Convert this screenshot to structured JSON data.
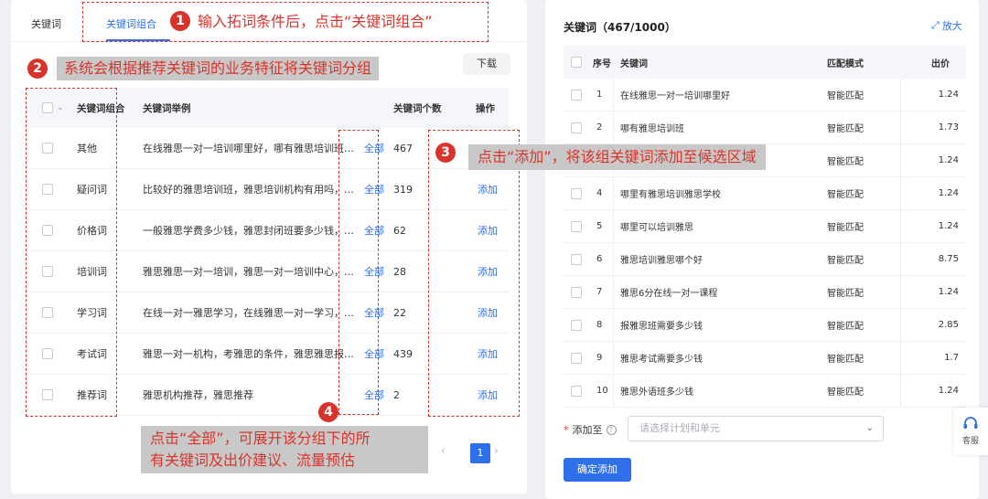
{
  "tabs": [
    {
      "label": "关键词"
    },
    {
      "label": "关键词组合"
    }
  ],
  "download_label": "下载",
  "left_table": {
    "headers": {
      "group": "关键词组合",
      "example": "关键词举例",
      "count": "关键词个数",
      "action": "操作"
    },
    "rows": [
      {
        "group": "其他",
        "example": "在线雅思一对一培训哪里好，哪有雅思培训班，雅思...",
        "all": "全部",
        "count": "467",
        "action": ""
      },
      {
        "group": "疑问词",
        "example": "比较好的雅思培训班，雅思培训机构有用吗，报考雅...",
        "all": "全部",
        "count": "319",
        "action": "添加"
      },
      {
        "group": "价格词",
        "example": "一般雅思学费多少钱，雅思封闭班要多少钱，考雅思...",
        "all": "全部",
        "count": "62",
        "action": "添加"
      },
      {
        "group": "培训词",
        "example": "雅思雅思一对一培训，雅思一对一培训中心，十佳雅...",
        "all": "全部",
        "count": "28",
        "action": "添加"
      },
      {
        "group": "学习词",
        "example": "在线一对一雅思学习，在线雅思一对一学习，雅思雅...",
        "all": "全部",
        "count": "22",
        "action": "添加"
      },
      {
        "group": "考试词",
        "example": "雅思一对一机构，考雅思的条件，雅思雅思报考，雅...",
        "all": "全部",
        "count": "439",
        "action": "添加"
      },
      {
        "group": "推荐词",
        "example": "雅思机构推荐，雅思推荐",
        "all": "全部",
        "count": "2",
        "action": "添加"
      }
    ]
  },
  "pagination": {
    "prev": "‹",
    "current": "1",
    "next": "›"
  },
  "annotations": [
    {
      "num": "1",
      "text": "输入拓词条件后，点击“关键词组合”"
    },
    {
      "num": "2",
      "text": "系统会根据推荐关键词的业务特征将关键词分组"
    },
    {
      "num": "3",
      "text": "点击“添加”，将该组关键词添加至候选区域"
    },
    {
      "num": "4",
      "text_line1": "点击“全部”，可展开该分组下的所",
      "text_line2": "有关键词及出价建议、流量预估"
    }
  ],
  "right_panel": {
    "title": "关键词（467/1000）",
    "expand_label": "放大",
    "headers": {
      "index": "序号",
      "keyword": "关键词",
      "match": "匹配模式",
      "bid": "出价"
    },
    "rows": [
      {
        "index": "1",
        "keyword": "在线雅思一对一培训哪里好",
        "match": "智能匹配",
        "bid": "1.24"
      },
      {
        "index": "2",
        "keyword": "哪有雅思培训班",
        "match": "智能匹配",
        "bid": "1.73"
      },
      {
        "index": "",
        "keyword": "",
        "match": "智能匹配",
        "bid": "1.24"
      },
      {
        "index": "4",
        "keyword": "哪里有雅思培训雅思学校",
        "match": "智能匹配",
        "bid": "1.24"
      },
      {
        "index": "5",
        "keyword": "哪里可以培训雅思",
        "match": "智能匹配",
        "bid": "1.24"
      },
      {
        "index": "6",
        "keyword": "雅思培训雅思哪个好",
        "match": "智能匹配",
        "bid": "8.75"
      },
      {
        "index": "7",
        "keyword": "雅思6分在线一对一课程",
        "match": "智能匹配",
        "bid": "1.24"
      },
      {
        "index": "8",
        "keyword": "报雅思班需要多少钱",
        "match": "智能匹配",
        "bid": "2.85"
      },
      {
        "index": "9",
        "keyword": "雅思考试需要多少钱",
        "match": "智能匹配",
        "bid": "1.7"
      },
      {
        "index": "10",
        "keyword": "雅思外语班多少钱",
        "match": "智能匹配",
        "bid": "1.24"
      }
    ],
    "add_to_label": "添加至",
    "add_to_required": "*",
    "add_to_placeholder": "请选择计划和单元",
    "confirm_label": "确定添加"
  },
  "support_label": "客服",
  "colors": {
    "accent": "#2f6fea",
    "annotation": "#d9342b"
  }
}
